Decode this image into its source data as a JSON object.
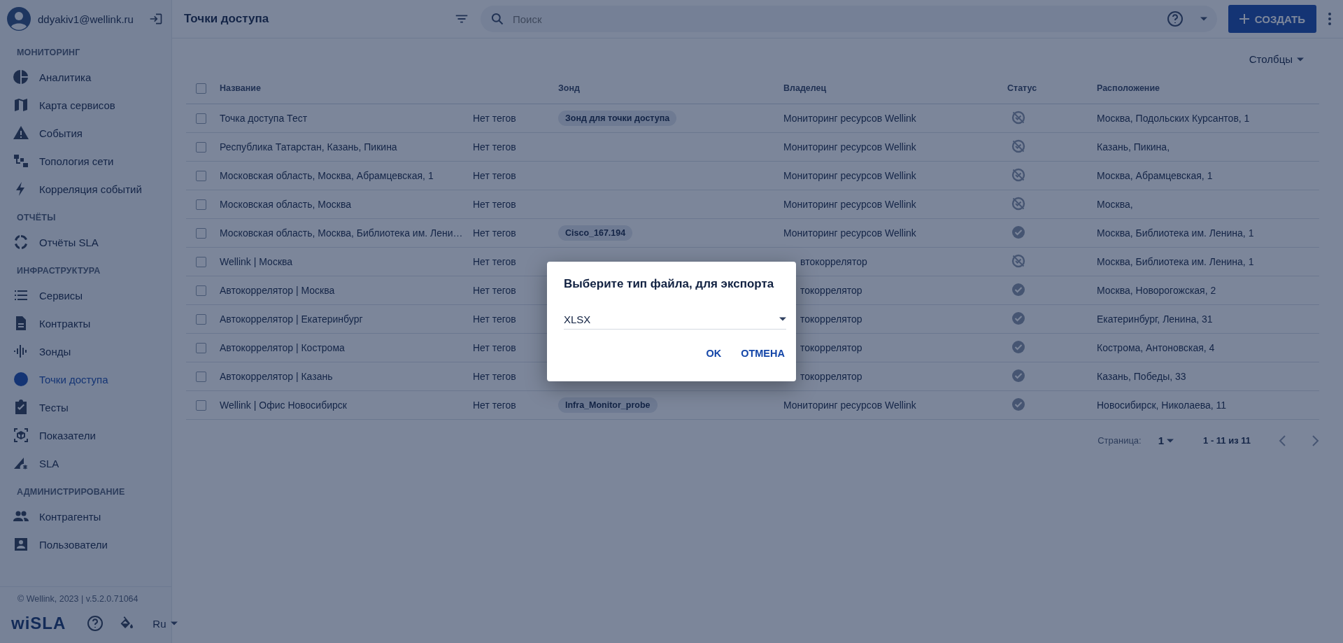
{
  "user": {
    "email": "ddyakiv1@wellink.ru"
  },
  "sidebar": {
    "sections": [
      {
        "title": "МОНИТОРИНГ",
        "items": [
          {
            "label": "Аналитика",
            "selected": false
          },
          {
            "label": "Карта сервисов",
            "selected": false
          },
          {
            "label": "События",
            "selected": false
          },
          {
            "label": "Топология сети",
            "selected": false
          },
          {
            "label": "Корреляция событий",
            "selected": false
          }
        ]
      },
      {
        "title": "ОТЧЁТЫ",
        "items": [
          {
            "label": "Отчёты SLA",
            "selected": false
          }
        ]
      },
      {
        "title": "ИНФРАСТРУКТУРА",
        "items": [
          {
            "label": "Сервисы",
            "selected": false
          },
          {
            "label": "Контракты",
            "selected": false
          },
          {
            "label": "Зонды",
            "selected": false
          },
          {
            "label": "Точки доступа",
            "selected": true
          },
          {
            "label": "Тесты",
            "selected": false
          },
          {
            "label": "Показатели",
            "selected": false
          },
          {
            "label": "SLA",
            "selected": false
          }
        ]
      },
      {
        "title": "АДМИНИСТРИРОВАНИЕ",
        "items": [
          {
            "label": "Контрагенты",
            "selected": false
          },
          {
            "label": "Пользователи",
            "selected": false
          }
        ]
      }
    ],
    "footer": "© Wellink, 2023 | v.5.2.0.71064",
    "logo": "wiSLA",
    "language": "Ru"
  },
  "header": {
    "title": "Точки доступа",
    "search": {
      "placeholder": "Поиск"
    },
    "create_button": "СОЗДАТЬ"
  },
  "columns_button": "Столбцы",
  "table": {
    "all_checked": false,
    "columns": [
      "Название",
      "",
      "Зонд",
      "Владелец",
      "Статус",
      "Расположение"
    ],
    "rows": [
      {
        "checked": false,
        "name": "Точка доступа Тест",
        "tags": "Нет тегов",
        "probe": "Зонд для точки доступа",
        "owner": "Мониторинг ресурсов Wellink",
        "monitored": false,
        "location": "Москва, Подольских Курсантов, 1"
      },
      {
        "checked": false,
        "name": "Республика Татарстан, Казань, Пикина",
        "tags": "Нет тегов",
        "owner": "Мониторинг ресурсов Wellink",
        "monitored": false,
        "location": "Казань, Пикина,"
      },
      {
        "checked": false,
        "name": "Московская область, Москва, Абрамцевская, 1",
        "tags": "Нет тегов",
        "owner": "Мониторинг ресурсов Wellink",
        "monitored": false,
        "location": "Москва, Абрамцевская, 1"
      },
      {
        "checked": false,
        "name": "Московская область, Москва",
        "tags": "Нет тегов",
        "owner": "Мониторинг ресурсов Wellink",
        "monitored": false,
        "location": "Москва,"
      },
      {
        "checked": false,
        "name": "Московская область, Москва, Библиотека им. Лени…",
        "tags": "Нет тегов",
        "probe": "Cisco_167.194",
        "owner": "Мониторинг ресурсов Wellink",
        "monitored": true,
        "location": "Москва, Библиотека им. Ленина, 1"
      },
      {
        "checked": false,
        "name": "Wellink | Москва",
        "tags": "Нет тегов",
        "owner": "втокоррелятор",
        "owner_covered": true,
        "monitored": false,
        "location": "Москва, Библиотека им. Ленина, 1"
      },
      {
        "checked": false,
        "name": "Автокоррелятор | Москва",
        "tags": "Нет тегов",
        "owner": "токоррелятор",
        "owner_covered": true,
        "monitored": true,
        "location": "Москва, Новорогожская, 2"
      },
      {
        "checked": false,
        "name": "Автокоррелятор | Екатеринбург",
        "tags": "Нет тегов",
        "owner": "токоррелятор",
        "owner_covered": true,
        "monitored": true,
        "location": "Екатеринбург, Ленина, 31"
      },
      {
        "checked": false,
        "name": "Автокоррелятор | Кострома",
        "tags": "Нет тегов",
        "owner": "токоррелятор",
        "owner_covered": true,
        "monitored": true,
        "location": "Кострома, Антоновская, 4"
      },
      {
        "checked": false,
        "name": "Автокоррелятор | Казань",
        "tags": "Нет тегов",
        "owner": "токоррелятор",
        "owner_covered": true,
        "monitored": true,
        "location": "Казань, Победы, 33"
      },
      {
        "checked": false,
        "name": "Wellink | Офис Новосибирск",
        "tags": "Нет тегов",
        "probe": "Infra_Monitor_probe",
        "owner": "Мониторинг ресурсов Wellink",
        "monitored": true,
        "location": "Новосибирск, Николаева, 11"
      }
    ]
  },
  "pagination": {
    "label": "Страница:",
    "page": "1",
    "range": "1 - 11 из 11"
  },
  "dialog": {
    "title": "Выберите тип файла, для экспорта",
    "value": "XLSX",
    "buttons": [
      "OK",
      "ОТМЕНА"
    ]
  }
}
